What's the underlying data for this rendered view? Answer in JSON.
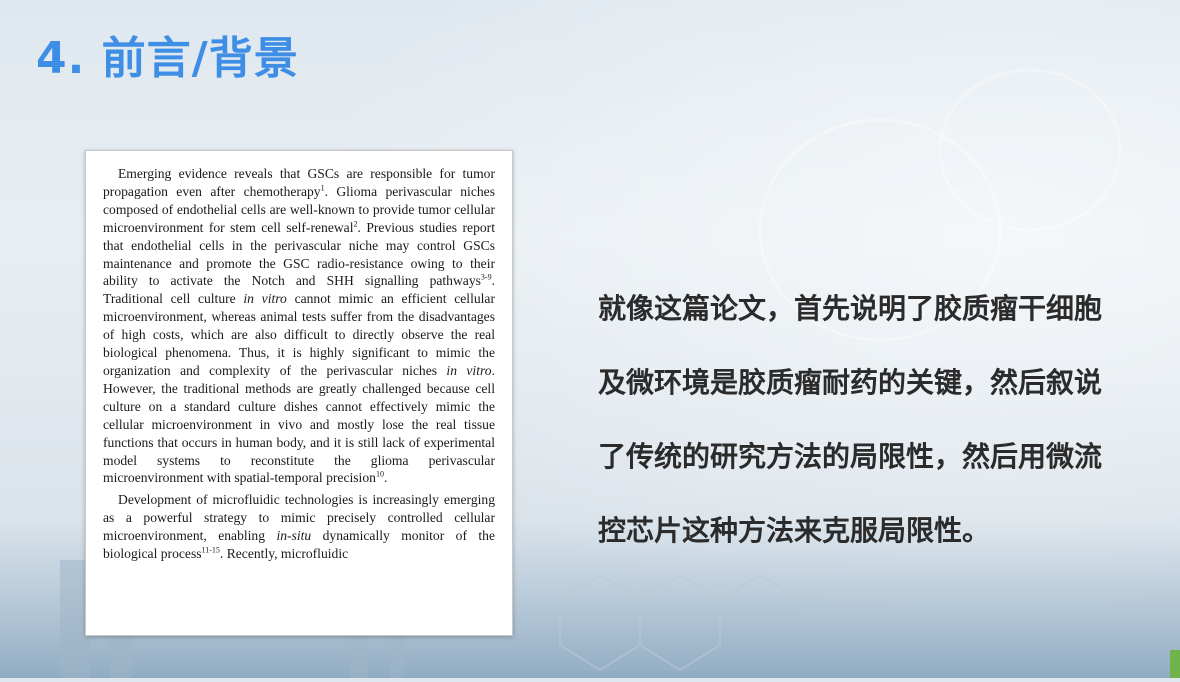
{
  "slide": {
    "title": "4. 前言/背景"
  },
  "paper_excerpt": {
    "paragraph1": [
      "Emerging evidence reveals that GSCs are responsible for tumor propagation even after chemotherapy",
      {
        "sup": "1"
      },
      ". Glioma perivascular niches composed of endothelial cells are well-known to provide tumor cellular microenvironment for stem cell self-renewal",
      {
        "sup": "2"
      },
      ". Previous studies report that endothelial cells in the perivascular niche may control GSCs maintenance and promote the GSC radio-resistance owing to their ability to activate the Notch and SHH signalling pathways",
      {
        "sup": "3-9"
      },
      ". Traditional cell culture ",
      {
        "i": "in vitro"
      },
      " cannot mimic an efficient cellular microenvironment, whereas animal tests suffer from the disadvantages of high costs, which are also difficult to directly observe the real biological phenomena. Thus, it is highly significant to mimic the organization and complexity of the perivascular niches ",
      {
        "i": "in vitro"
      },
      ". However, the traditional methods are greatly challenged because cell culture on a standard culture dishes cannot effectively mimic the cellular microenvironment in vivo and mostly lose the real tissue functions that occurs in human body, and it is still lack of experimental model systems to reconstitute the glioma perivascular microenvironment with spatial-temporal precision",
      {
        "sup": "10"
      },
      "."
    ],
    "paragraph2": [
      "Development of microfluidic technologies is increasingly emerging as a powerful strategy to mimic precisely controlled cellular microenvironment, enabling ",
      {
        "i": "in-situ"
      },
      " dynamically monitor of the biological process",
      {
        "sup": "11-15"
      },
      ". Recently, microfluidic"
    ]
  },
  "commentary": {
    "lines": [
      "就像这篇论文，首先说明了胶质瘤干细胞",
      "及微环境是胶质瘤耐药的关键，然后叙说",
      "了传统的研究方法的局限性，然后用微流",
      "控芯片这种方法来克服局限性。"
    ]
  },
  "colors": {
    "title": "#3f8ee6",
    "body_text": "#2b2b2b"
  }
}
